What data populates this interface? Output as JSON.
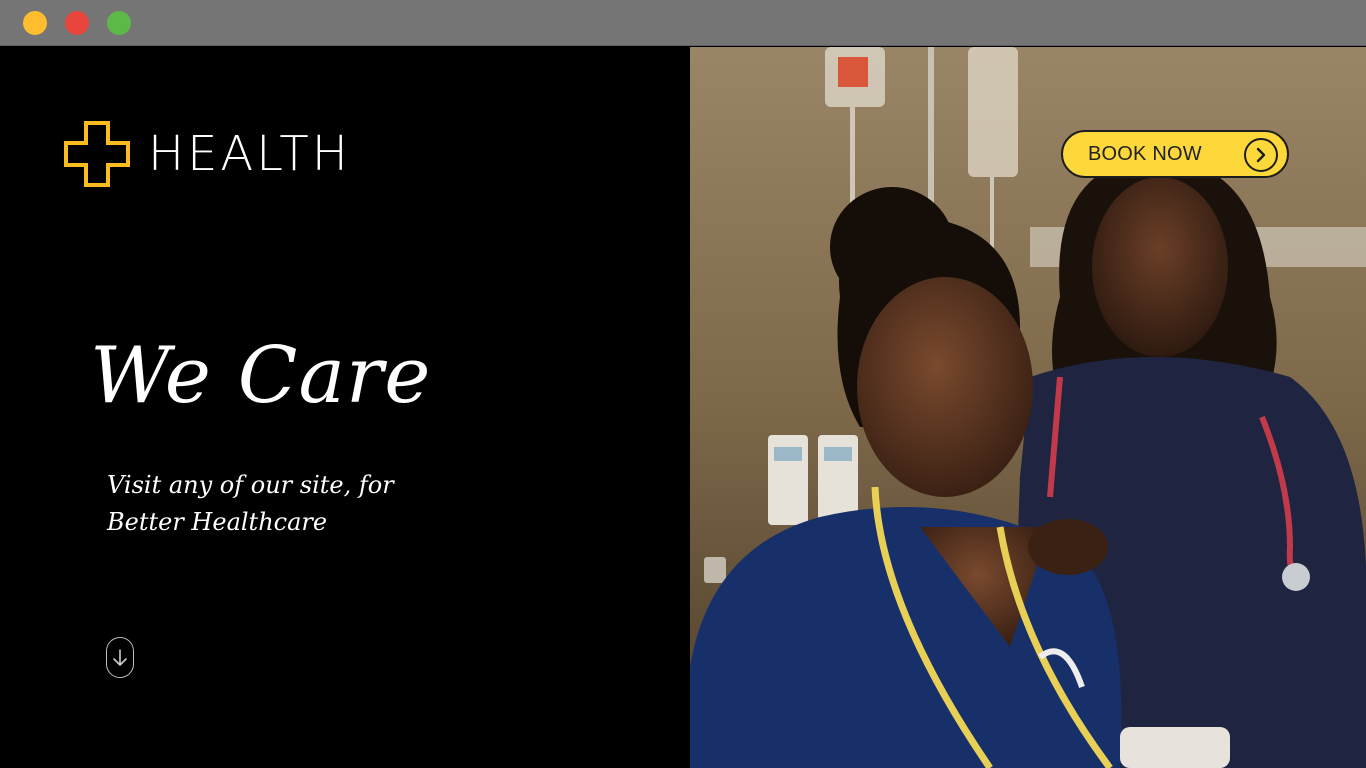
{
  "window": {
    "controls": [
      "minimize",
      "close",
      "maximize"
    ]
  },
  "brand": {
    "name": "HEALTH",
    "icon": "medical-cross-icon",
    "accent_color": "#fcbc1d"
  },
  "hero": {
    "headline": "We Care",
    "subline": [
      "Visit any of our site, for",
      "Better Healthcare"
    ],
    "scroll_icon": "scroll-down-icon"
  },
  "cta": {
    "label": "BOOK NOW",
    "icon": "chevron-right-circle-icon",
    "color": "#fcd83a"
  },
  "colors": {
    "background": "#000000",
    "text": "#ffffff",
    "titlebar": "#757575"
  }
}
